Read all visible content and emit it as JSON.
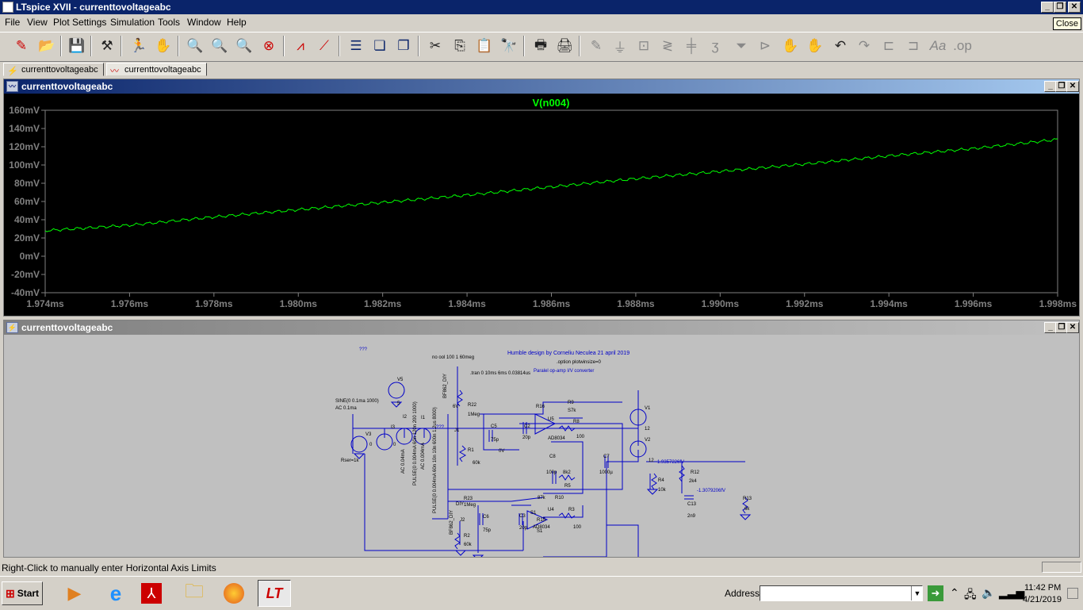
{
  "window": {
    "title": "LTspice XVII - currenttovoltageabc",
    "tooltip": "Close"
  },
  "menu": [
    "File",
    "View",
    "Plot Settings",
    "Simulation",
    "Tools",
    "Window",
    "Help"
  ],
  "tabs": [
    {
      "label": "currenttovoltageabc",
      "icon": "schematic-icon"
    },
    {
      "label": "currenttovoltageabc",
      "icon": "waveform-icon"
    }
  ],
  "wave_window": {
    "title": "currenttovoltageabc"
  },
  "chart_data": {
    "type": "line",
    "title": "V(n004)",
    "series": [
      {
        "name": "V(n004)",
        "color": "#00ff00",
        "x": [
          1.974,
          1.976,
          1.978,
          1.98,
          1.982,
          1.984,
          1.986,
          1.988,
          1.99,
          1.992,
          1.994,
          1.996,
          1.998
        ],
        "values": [
          28,
          34,
          43,
          51,
          59,
          67,
          76,
          85,
          93,
          101,
          110,
          118,
          128
        ]
      }
    ],
    "ylim": [
      -40,
      160
    ],
    "xlim": [
      1.974,
      1.998
    ],
    "y_ticks": [
      "160mV",
      "140mV",
      "120mV",
      "100mV",
      "80mV",
      "60mV",
      "40mV",
      "20mV",
      "0mV",
      "-20mV",
      "-40mV"
    ],
    "x_ticks": [
      "1.974ms",
      "1.976ms",
      "1.978ms",
      "1.980ms",
      "1.982ms",
      "1.984ms",
      "1.986ms",
      "1.988ms",
      "1.990ms",
      "1.992ms",
      "1.994ms",
      "1.996ms",
      "1.998ms"
    ],
    "background": "#000000",
    "trace_color": "#00ff00"
  },
  "schematic_window": {
    "title": "currenttovoltageabc"
  },
  "schematic": {
    "header": "Humble design by Corneliu Neculea 21 april 2019",
    "option": ".option plotwinsize=0",
    "desc": "Paralel op-amp I/V converter",
    "noise": ".tran 0 10ms 6ms 0.03814us",
    "noise2": "no ool 100 1 60meg",
    "qqq": "???",
    "qqq2": "???",
    "sine": "SINE(0 0.1ma 1000)",
    "ac": "AC 0.1ma",
    "rser": "Rser=1k",
    "pulse1": "PULSE(0 0.004mA 60n 120n 200 1000)",
    "pulse2": "PULSE(0 0.004mA 60n 10n 10n 600n 1.2us 8000)",
    "ac1": "AC 0.04mA",
    "ac2": "AC 0.004mA",
    "bf": "BF862_DIY",
    "bf2": "BF862_DIY",
    "labels": [
      {
        "t": "V5"
      },
      {
        "t": "5"
      },
      {
        "t": "V3"
      },
      {
        "t": "0"
      },
      {
        "t": "I3"
      },
      {
        "t": "I2"
      },
      {
        "t": "I1"
      },
      {
        "t": "0"
      },
      {
        "t": "6V"
      },
      {
        "t": "R22"
      },
      {
        "t": "1Meg"
      },
      {
        "t": "J1"
      },
      {
        "t": "C5"
      },
      {
        "t": "75p"
      },
      {
        "t": "0V"
      },
      {
        "t": "C2"
      },
      {
        "t": "20p"
      },
      {
        "t": "R1"
      },
      {
        "t": "60k"
      },
      {
        "t": "R16"
      },
      {
        "t": "S7k"
      },
      {
        "t": "R9"
      },
      {
        "t": "U5"
      },
      {
        "t": "R8"
      },
      {
        "t": "AD8034"
      },
      {
        "t": "100"
      },
      {
        "t": "C8"
      },
      {
        "t": "100p"
      },
      {
        "t": "8k2"
      },
      {
        "t": "C7"
      },
      {
        "t": "1000µ"
      },
      {
        "t": "R5"
      },
      {
        "t": "V1"
      },
      {
        "t": "12"
      },
      {
        "t": "V2"
      },
      {
        "t": "12"
      },
      {
        "t": "-1.9357226fV"
      },
      {
        "t": "R12"
      },
      {
        "t": "2k4"
      },
      {
        "t": "-1.3079206fV"
      },
      {
        "t": "R13"
      },
      {
        "t": "6k"
      },
      {
        "t": "C13"
      },
      {
        "t": "2n9"
      },
      {
        "t": "R4"
      },
      {
        "t": "10k"
      },
      {
        "t": "R23"
      },
      {
        "t": "1Meg"
      },
      {
        "t": "J2"
      },
      {
        "t": "C6"
      },
      {
        "t": "75p"
      },
      {
        "t": "C3"
      },
      {
        "t": "20p"
      },
      {
        "t": "87k"
      },
      {
        "t": "R10"
      },
      {
        "t": "U4"
      },
      {
        "t": "R3"
      },
      {
        "t": "AD8034"
      },
      {
        "t": "100"
      },
      {
        "t": "R2"
      },
      {
        "t": "60k"
      },
      {
        "t": "R15"
      },
      {
        "t": "S1"
      },
      {
        "t": "S1"
      },
      {
        "t": "DIY"
      }
    ]
  },
  "status": {
    "text": "Right-Click to manually enter Horizontal Axis Limits"
  },
  "taskbar": {
    "start": "Start",
    "address_label": "Address",
    "address_value": "",
    "time": "11:42 PM",
    "date": "4/21/2019"
  }
}
